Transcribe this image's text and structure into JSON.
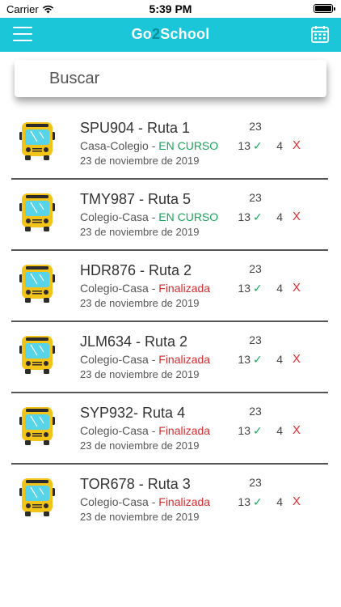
{
  "status_bar": {
    "carrier": "Carrier",
    "time": "5:39 PM"
  },
  "nav": {
    "title_pre": "Go",
    "title_num": "2",
    "title_post": "School",
    "menu_icon": "hamburger-menu-icon",
    "calendar_icon": "calendar-icon"
  },
  "search": {
    "placeholder": "Buscar"
  },
  "colors": {
    "header": "#1ac6d8",
    "active": "#1aa35a",
    "finished": "#d42d2d",
    "bus": "#f2c318"
  },
  "routes": [
    {
      "title": "SPU904 - Ruta 1",
      "direction": "Casa-Colegio - ",
      "status": "EN CURSO",
      "status_kind": "active",
      "date": "23 de noviembre de 2019",
      "total": "23",
      "ok": "13",
      "check": "✓",
      "bad": "4",
      "x": "X"
    },
    {
      "title": "TMY987 - Ruta 5",
      "direction": "Colegio-Casa - ",
      "status": "EN CURSO",
      "status_kind": "active",
      "date": "23 de noviembre de 2019",
      "total": "23",
      "ok": "13",
      "check": "✓",
      "bad": "4",
      "x": "X"
    },
    {
      "title": "HDR876 - Ruta 2",
      "direction": "Colegio-Casa - ",
      "status": "Finalizada",
      "status_kind": "done",
      "date": "23 de noviembre de 2019",
      "total": "23",
      "ok": "13",
      "check": "✓",
      "bad": "4",
      "x": "X"
    },
    {
      "title": "JLM634 - Ruta 2",
      "direction": "Colegio-Casa - ",
      "status": "Finalizada",
      "status_kind": "done",
      "date": "23 de noviembre de 2019",
      "total": "23",
      "ok": "13",
      "check": "✓",
      "bad": "4",
      "x": "X"
    },
    {
      "title": "SYP932- Ruta 4",
      "direction": "Colegio-Casa - ",
      "status": "Finalizada",
      "status_kind": "done",
      "date": "23 de noviembre de 2019",
      "total": "23",
      "ok": "13",
      "check": "✓",
      "bad": "4",
      "x": "X"
    },
    {
      "title": "TOR678 - Ruta 3",
      "direction": "Colegio-Casa - ",
      "status": "Finalizada",
      "status_kind": "done",
      "date": "23 de noviembre de 2019",
      "total": "23",
      "ok": "13",
      "check": "✓",
      "bad": "4",
      "x": "X"
    }
  ]
}
